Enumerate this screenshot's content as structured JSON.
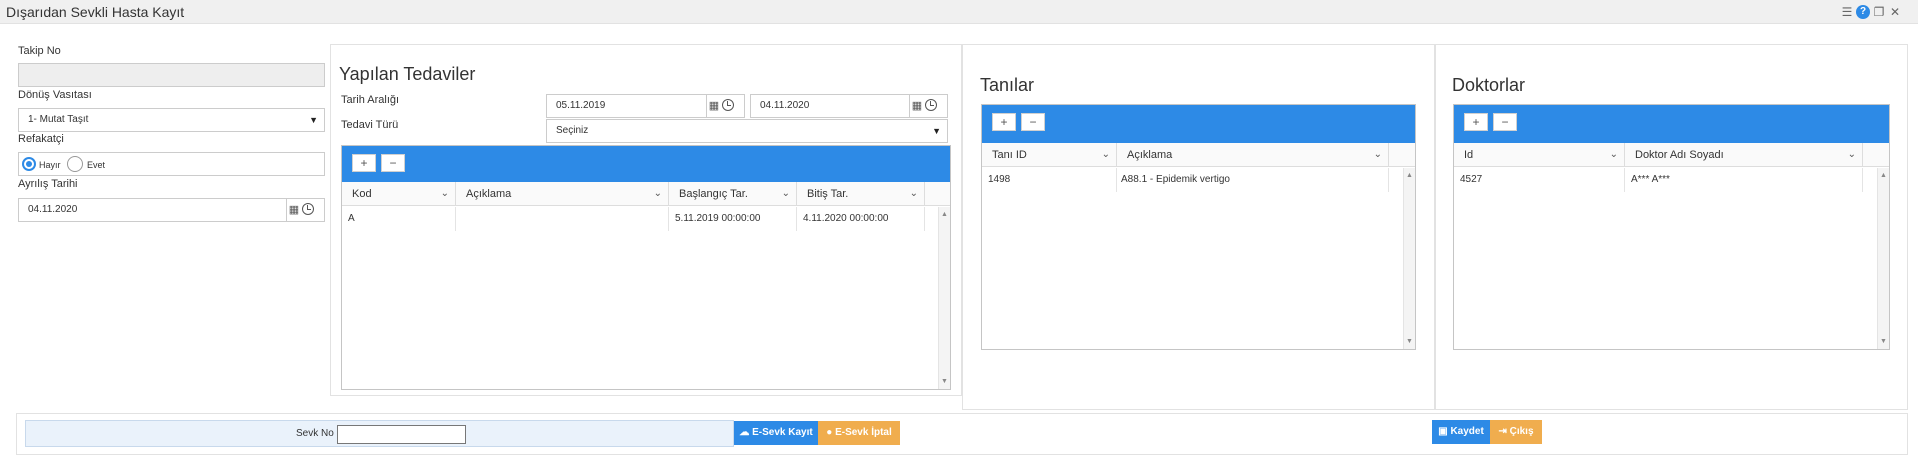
{
  "window": {
    "title": "Dışarıdan Sevkli Hasta Kayıt",
    "icons": [
      "settings-sliders-icon",
      "help-icon",
      "restore-icon",
      "close-icon"
    ]
  },
  "left_form": {
    "takip_no_label": "Takip No",
    "takip_no_value": "",
    "donus_label": "Dönüş Vasıtası",
    "donus_value": "1- Mutat Taşıt",
    "refakatci_label": "Refakatçi",
    "refakatci_options": [
      "Hayır",
      "Evet"
    ],
    "refakatci_selected": "Hayır",
    "ayrilis_label": "Ayrılış Tarihi",
    "ayrilis_value": "04.11.2020"
  },
  "treatments": {
    "title": "Yapılan Tedaviler",
    "date_range_label": "Tarih Aralığı",
    "date_from": "05.11.2019",
    "date_to": "04.11.2020",
    "type_label": "Tedavi Türü",
    "type_value": "Seçiniz",
    "add_label": "+",
    "remove_label": "−",
    "columns": [
      "Kod",
      "Açıklama",
      "Başlangıç Tar.",
      "Bitiş Tar."
    ],
    "rows": [
      {
        "kod": "A",
        "aciklama": "",
        "baslangic": "5.11.2019 00:00:00",
        "bitis": "4.11.2020 00:00:00"
      }
    ]
  },
  "diagnoses": {
    "title": "Tanılar",
    "add_label": "+",
    "remove_label": "−",
    "columns": [
      "Tanı ID",
      "Açıklama"
    ],
    "rows": [
      {
        "id": "1498",
        "aciklama": "A88.1 - Epidemik vertigo"
      }
    ]
  },
  "doctors": {
    "title": "Doktorlar",
    "add_label": "+",
    "remove_label": "−",
    "columns": [
      "Id",
      "Doktor Adı Soyadı"
    ],
    "rows": [
      {
        "id": "4527",
        "name": "A*** A***"
      }
    ]
  },
  "footer": {
    "sevk_no_label": "Sevk No",
    "sevk_no_value": "",
    "esevk_kayit": "E-Sevk Kayıt",
    "esevk_iptal": "E-Sevk İptal",
    "kaydet": "Kaydet",
    "cikis": "Çıkış"
  },
  "colors": {
    "primary": "#2d8ae6",
    "warning": "#f0ad4e"
  }
}
